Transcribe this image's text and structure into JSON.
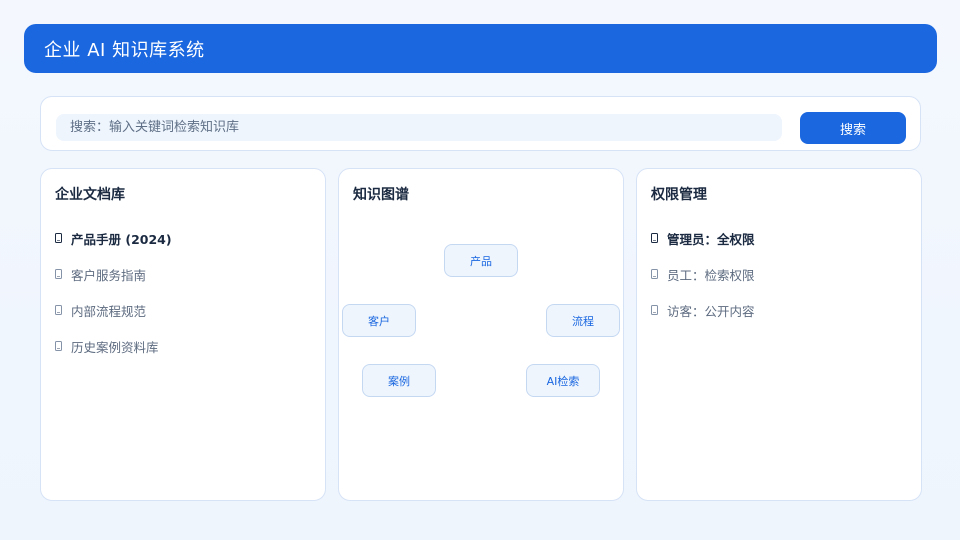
{
  "header": {
    "title": "企业 AI 知识库系统"
  },
  "search": {
    "placeholder": "搜索：输入关键词检索知识库",
    "button_label": "搜索"
  },
  "docs": {
    "title": "企业文档库",
    "items": [
      {
        "label": "产品手册 (2024)",
        "active": true
      },
      {
        "label": "客户服务指南",
        "active": false
      },
      {
        "label": "内部流程规范",
        "active": false
      },
      {
        "label": "历史案例资料库",
        "active": false
      }
    ]
  },
  "graph": {
    "title": "知识图谱",
    "nodes": {
      "product": "产品",
      "customer": "客户",
      "process": "流程",
      "case": "案例",
      "ai": "AI检索"
    }
  },
  "permissions": {
    "title": "权限管理",
    "items": [
      {
        "label": "管理员：全权限",
        "active": true
      },
      {
        "label": "员工：检索权限",
        "active": false
      },
      {
        "label": "访客：公开内容",
        "active": false
      }
    ]
  },
  "colors": {
    "primary": "#1a67e0",
    "background": "#eef5fd",
    "text_dark": "#1b2a41",
    "text_muted": "#5d6b80"
  },
  "icons": {
    "list_item": "mobile-phone-icon"
  }
}
